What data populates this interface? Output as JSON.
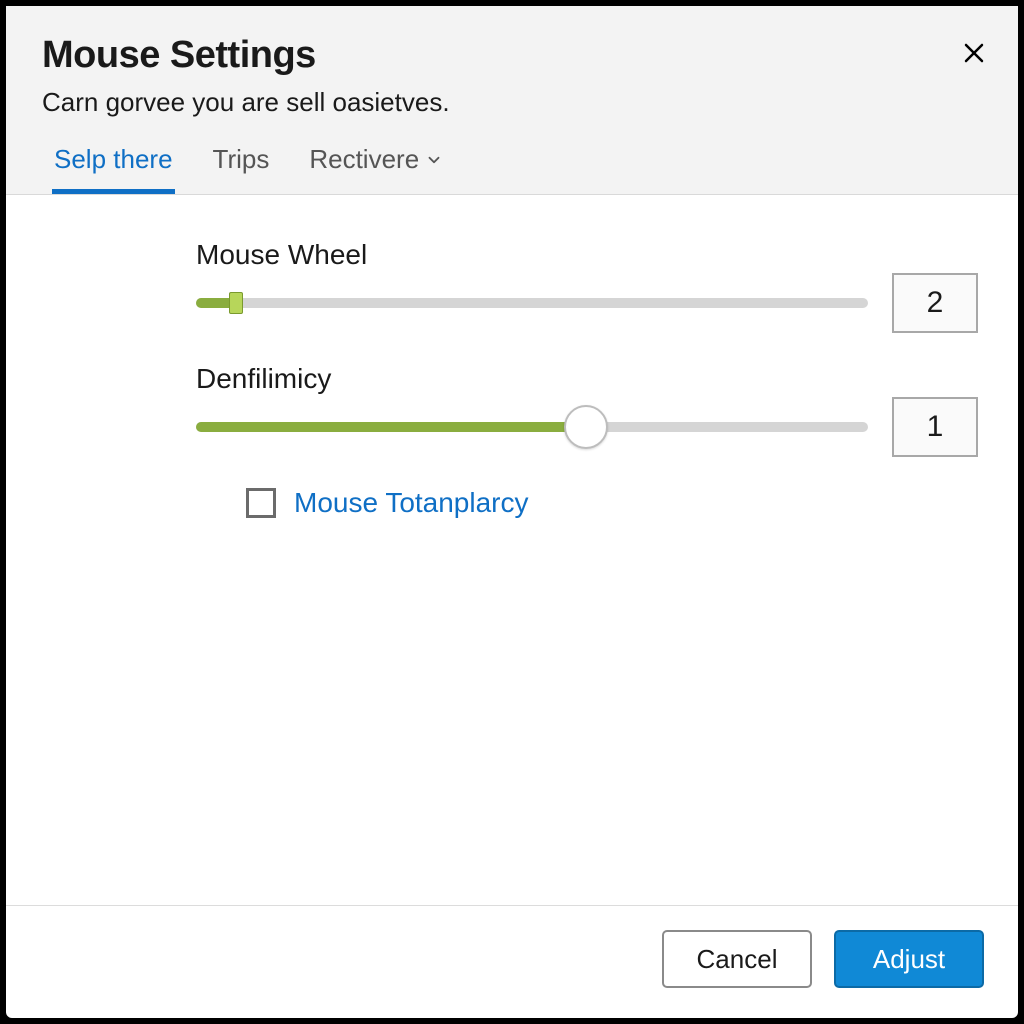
{
  "header": {
    "title": "Mouse Settings",
    "subtitle": "Carn gorvee you are sell oasietves."
  },
  "tabs": [
    {
      "label": "Selp there",
      "active": true,
      "has_dropdown": false
    },
    {
      "label": "Trips",
      "active": false,
      "has_dropdown": false
    },
    {
      "label": "Rectivere",
      "active": false,
      "has_dropdown": true
    }
  ],
  "sliders": {
    "mouse_wheel": {
      "label": "Mouse Wheel",
      "value": "2",
      "fill_percent": 6
    },
    "denfilimicy": {
      "label": "Denfilimicy",
      "value": "1",
      "fill_percent": 58
    }
  },
  "checkbox": {
    "label": "Mouse Totanplarcy",
    "checked": false
  },
  "footer": {
    "cancel": "Cancel",
    "adjust": "Adjust"
  }
}
